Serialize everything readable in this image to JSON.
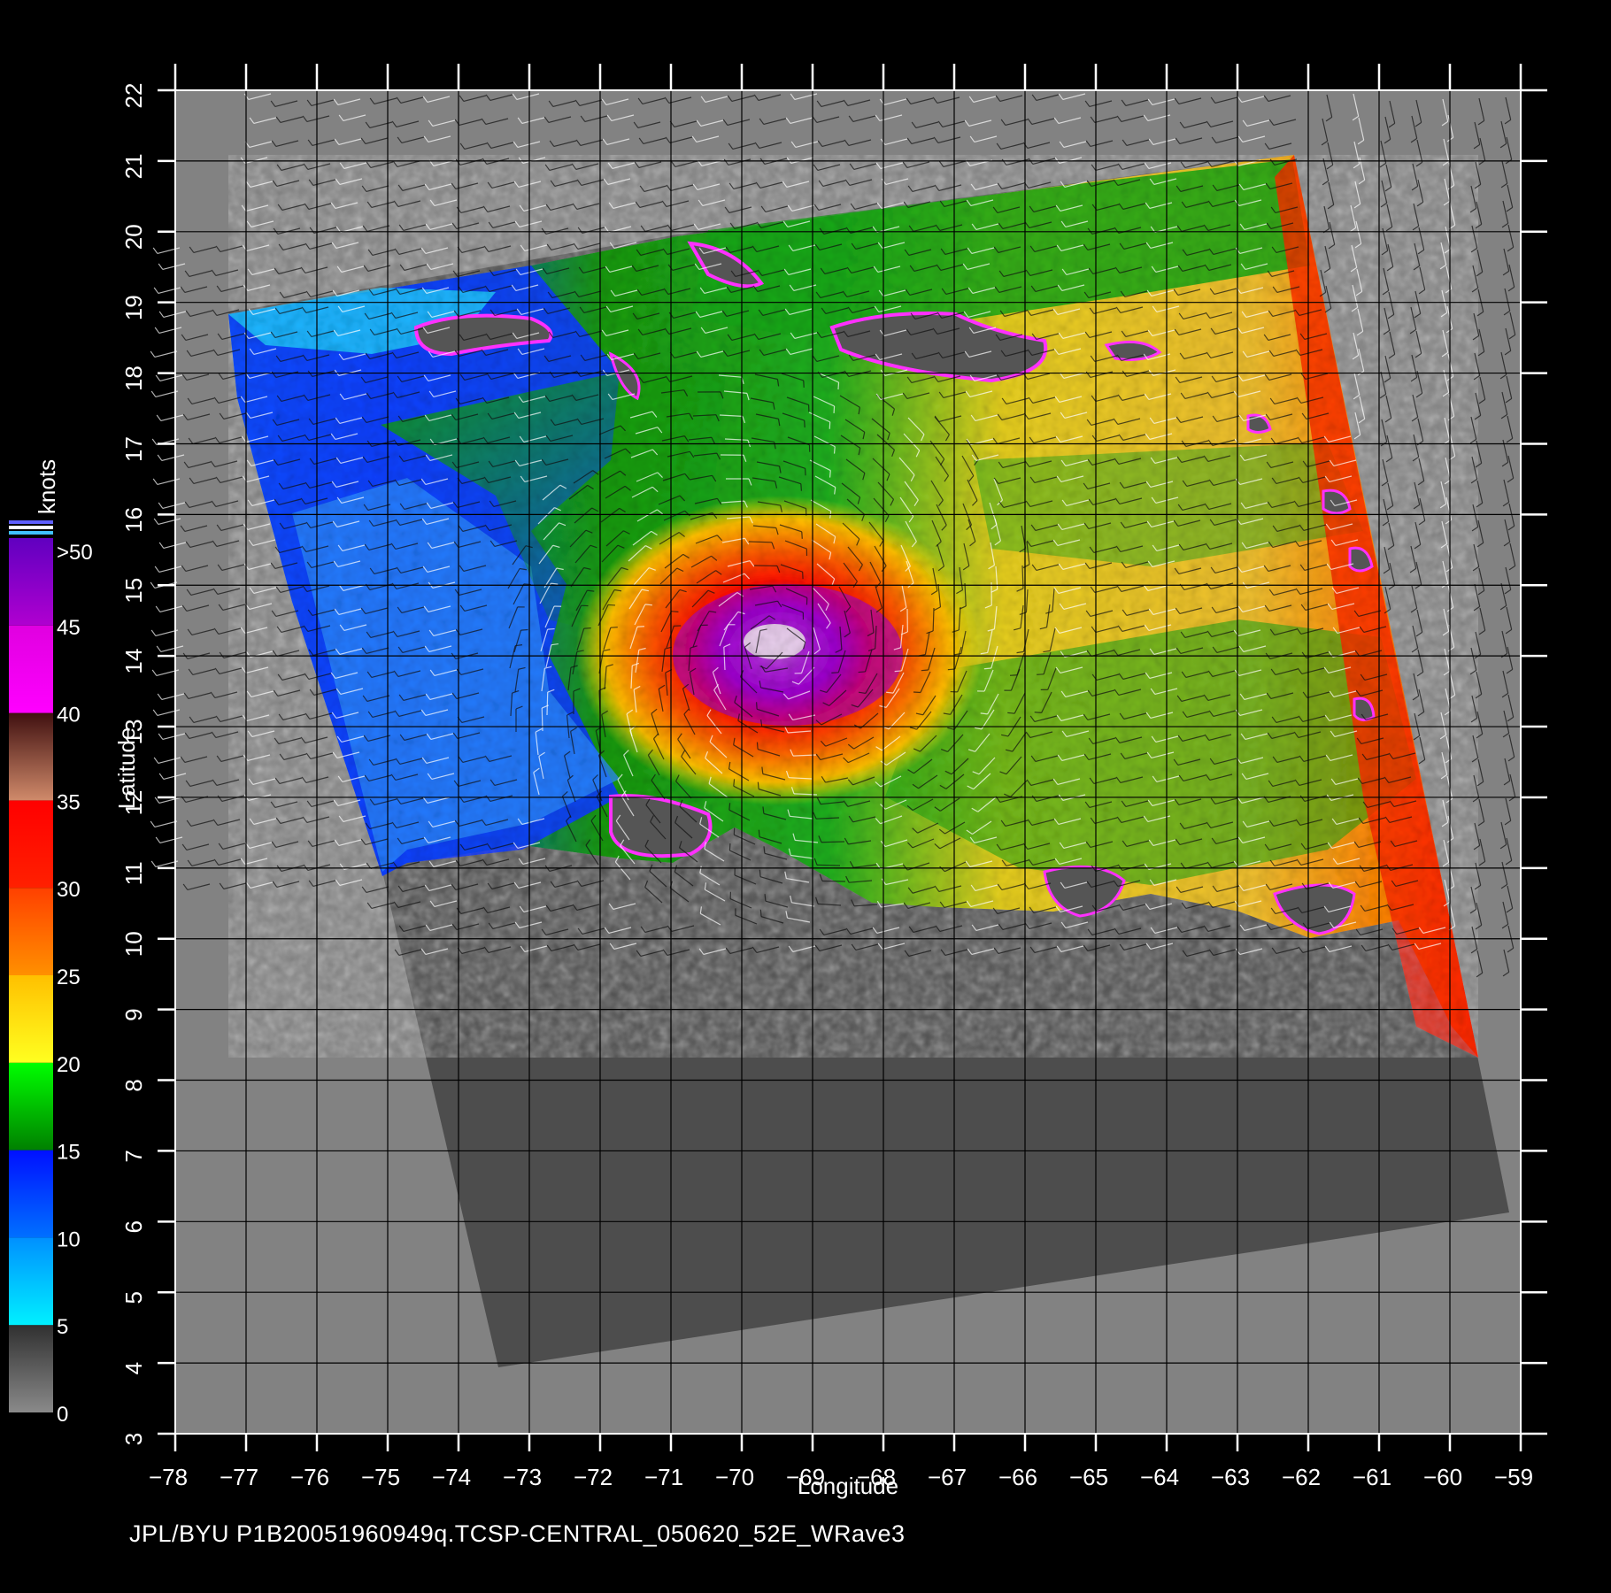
{
  "figure": {
    "caption": "JPL/BYU  P1B20051960949q.TCSP-CENTRAL_050620_52E_WRave3",
    "colorbar_label": "knots",
    "axes": {
      "xlabel": "Longitude",
      "ylabel": "Latitude",
      "lon_range": [
        -78,
        -59
      ],
      "lat_range": [
        3,
        22
      ],
      "lon_ticks": [
        "−78",
        "−77",
        "−76",
        "−75",
        "−74",
        "−73",
        "−72",
        "−71",
        "−70",
        "−69",
        "−68",
        "−67",
        "−66",
        "−65",
        "−64",
        "−63",
        "−62",
        "−61",
        "−60",
        "−59"
      ],
      "lat_ticks": [
        "3",
        "4",
        "5",
        "6",
        "7",
        "8",
        "9",
        "10",
        "11",
        "12",
        "13",
        "14",
        "15",
        "16",
        "17",
        "18",
        "19",
        "20",
        "21",
        "22"
      ],
      "grid": true
    },
    "colorbar": {
      "tick_labels": [
        "0",
        "5",
        "10",
        "15",
        "20",
        "25",
        "30",
        "35",
        "40",
        "45",
        ">50"
      ],
      "bands": [
        {
          "from": 0,
          "to": 5,
          "colors": [
            "#8a8a8a",
            "#303030"
          ]
        },
        {
          "from": 5,
          "to": 10,
          "colors": [
            "#00f0ff",
            "#0090ff"
          ]
        },
        {
          "from": 10,
          "to": 15,
          "colors": [
            "#0070ff",
            "#0010ff"
          ]
        },
        {
          "from": 15,
          "to": 20,
          "colors": [
            "#008000",
            "#00ff00"
          ]
        },
        {
          "from": 20,
          "to": 25,
          "colors": [
            "#ffff20",
            "#ffc000"
          ]
        },
        {
          "from": 25,
          "to": 30,
          "colors": [
            "#ff9000",
            "#ff4000"
          ]
        },
        {
          "from": 30,
          "to": 35,
          "colors": [
            "#ff2000",
            "#ff0000"
          ]
        },
        {
          "from": 35,
          "to": 40,
          "colors": [
            "#d08a6a",
            "#401010"
          ]
        },
        {
          "from": 40,
          "to": 45,
          "colors": [
            "#ff00ff",
            "#e000e0"
          ]
        },
        {
          "from": 45,
          "to": 50,
          "colors": [
            "#b000d0",
            "#6000c0"
          ]
        }
      ]
    },
    "colors": {
      "background": "#000000",
      "plot_background": "#828282",
      "swath_nodata": "#4d4d4d",
      "grid": "#000000",
      "land": "#555555"
    }
  }
}
